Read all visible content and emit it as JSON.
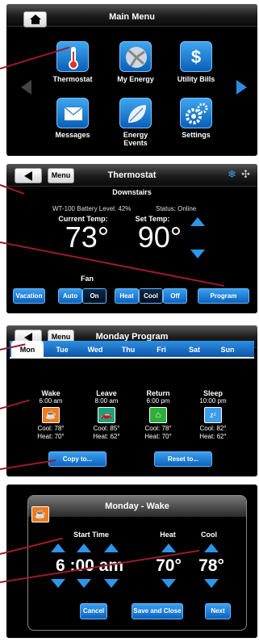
{
  "main_menu": {
    "title": "Main Menu",
    "items": [
      {
        "label": "Thermostat",
        "icon": "thermometer-icon"
      },
      {
        "label": "My Energy",
        "icon": "meter-icon"
      },
      {
        "label": "Utility Bills",
        "icon": "dollar-icon"
      },
      {
        "label": "Messages",
        "icon": "envelope-icon"
      },
      {
        "label": "Energy\nEvents",
        "icon": "leaf-icon"
      },
      {
        "label": "Settings",
        "icon": "gears-icon"
      }
    ]
  },
  "thermostat": {
    "menu_label": "Menu",
    "title": "Thermostat",
    "location": "Downstairs",
    "battery": "WT-100 Battery Level: 42%",
    "status": "Status: Online",
    "current_label": "Current Temp:",
    "set_label": "Set Temp:",
    "current_value": "73°",
    "set_value": "90°",
    "fan_label": "Fan",
    "vacation": "Vacation",
    "fan_auto": "Auto",
    "fan_on": "On",
    "heat": "Heat",
    "cool": "Cool",
    "off": "Off",
    "program": "Program"
  },
  "program": {
    "menu_label": "Menu",
    "title": "Monday Program",
    "tabs": [
      "Mon",
      "Tue",
      "Wed",
      "Thu",
      "Fri",
      "Sat",
      "Sun"
    ],
    "periods": [
      {
        "name": "Wake",
        "time": "6:00 am",
        "cool": "Cool: 78°",
        "heat": "Heat: 70°"
      },
      {
        "name": "Leave",
        "time": "8:00 am",
        "cool": "Cool: 85°",
        "heat": "Heat: 62°"
      },
      {
        "name": "Return",
        "time": "6:00 pm",
        "cool": "Cool: 78°",
        "heat": "Heat: 70°"
      },
      {
        "name": "Sleep",
        "time": "10:00 pm",
        "cool": "Cool: 82°",
        "heat": "Heat: 62°"
      }
    ],
    "copy": "Copy to...",
    "reset": "Reset to..."
  },
  "wake": {
    "title": "Monday - Wake",
    "start_label": "Start Time",
    "heat_label": "Heat",
    "cool_label": "Cool",
    "time": "6 :00 am",
    "heat_value": "70°",
    "cool_value": "78°",
    "cancel": "Cancel",
    "save": "Save and Close",
    "next": "Next"
  }
}
